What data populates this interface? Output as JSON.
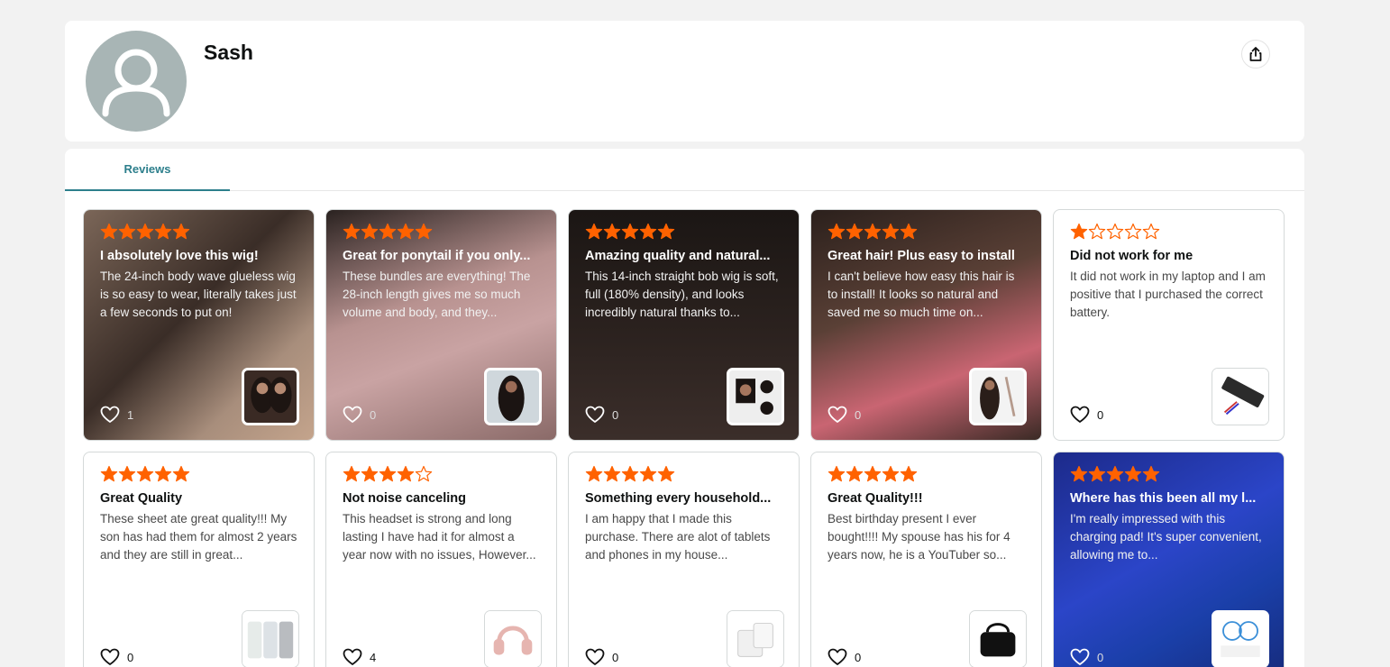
{
  "profile": {
    "name": "Sash",
    "share_icon": "share-icon",
    "avatar_icon": "default-avatar-icon"
  },
  "tabs": [
    {
      "label": "Reviews",
      "active": true
    }
  ],
  "colors": {
    "star": "#ff6200",
    "accent": "#2d7f8c"
  },
  "reviews": [
    {
      "rating": 5,
      "title": "I absolutely love this wig!",
      "body": "The 24-inch body wave glueless wig is so easy to wear, literally takes just a few seconds to put on!",
      "likes": "1",
      "dark": true,
      "bg": "linear-gradient(135deg,#7b6658 0%,#3a2d27 45%,#a88e7c 75%,#c4a48c 100%)",
      "thumb": "wig-photo"
    },
    {
      "rating": 5,
      "title": "Great for ponytail if you only...",
      "body": "These bundles are everything! The 28-inch length gives me so much volume and body, and they...",
      "likes": "0",
      "dark": true,
      "bg": "linear-gradient(160deg,#2a2220 0%,#b89290 40%,#c9a3a3 60%,#8a6a68 100%)",
      "thumb": "bundles-photo"
    },
    {
      "rating": 5,
      "title": "Amazing quality and natural...",
      "body": "This 14-inch straight bob wig is soft, full (180% density), and looks incredibly natural thanks to...",
      "likes": "0",
      "dark": true,
      "bg": "linear-gradient(180deg,#1b1614 0%,#2a211e 50%,#3b2e2a 100%)",
      "thumb": "bob-wig-photo"
    },
    {
      "rating": 5,
      "title": "Great hair! Plus easy to install",
      "body": "I can't believe how easy this hair is to install! It looks so natural and saved me so much time on...",
      "likes": "0",
      "dark": true,
      "bg": "linear-gradient(160deg,#2b201c 0%,#5a4036 40%,#c96572 70%,#3a2a25 100%)",
      "thumb": "curly-hair-photo"
    },
    {
      "rating": 1,
      "title": "Did not work for me",
      "body": "It did not work in my laptop and I am positive that I purchased the correct battery.",
      "likes": "0",
      "dark": false,
      "bg": "",
      "thumb": "battery-photo"
    },
    {
      "rating": 5,
      "title": "Great Quality",
      "body": "These sheet ate great quality!!! My son has had them for almost 2 years and they are still in great...",
      "likes": "0",
      "dark": false,
      "bg": "",
      "thumb": "sheets-photo"
    },
    {
      "rating": 4,
      "title": "Not noise canceling",
      "body": "This headset is strong and long lasting I have had it for almost a year now with no issues, However...",
      "likes": "4",
      "dark": false,
      "bg": "",
      "thumb": "headset-photo"
    },
    {
      "rating": 5,
      "title": "Something every household...",
      "body": "I am happy that I made this purchase. There are alot of tablets and phones in my house...",
      "likes": "0",
      "dark": false,
      "bg": "",
      "thumb": "charger-photo"
    },
    {
      "rating": 5,
      "title": "Great Quality!!!",
      "body": "Best birthday present I ever bought!!!! My spouse has his for 4 years now, he is a YouTuber so...",
      "likes": "0",
      "dark": false,
      "bg": "",
      "thumb": "camera-bag-photo"
    },
    {
      "rating": 5,
      "title": "Where has this been all my l...",
      "body": "I'm really impressed with this charging pad! It's super convenient, allowing me to...",
      "likes": "0",
      "dark": true,
      "bg": "linear-gradient(150deg,#1c2a8a 0%,#2b45c8 45%,#1a3fa8 70%,#162a7a 100%)",
      "thumb": "cable-photo"
    }
  ]
}
